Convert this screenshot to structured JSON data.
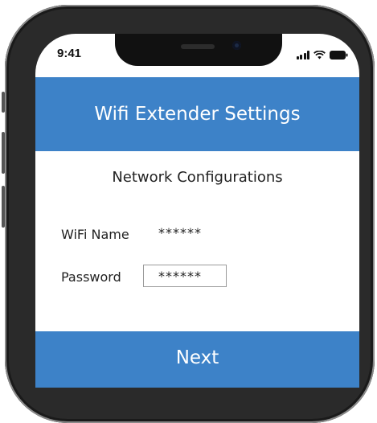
{
  "status_bar": {
    "time": "9:41",
    "icons": [
      "signal-icon",
      "wifi-icon",
      "battery-icon"
    ]
  },
  "header": {
    "title": "Wifi Extender Settings"
  },
  "section": {
    "title": "Network Configurations"
  },
  "form": {
    "wifi_name": {
      "label": "WiFi Name",
      "value": "******"
    },
    "password": {
      "label": "Password",
      "value": "******"
    }
  },
  "actions": {
    "next_label": "Next"
  },
  "colors": {
    "accent": "#3d82c8",
    "phone_frame": "#2a2a2a"
  }
}
